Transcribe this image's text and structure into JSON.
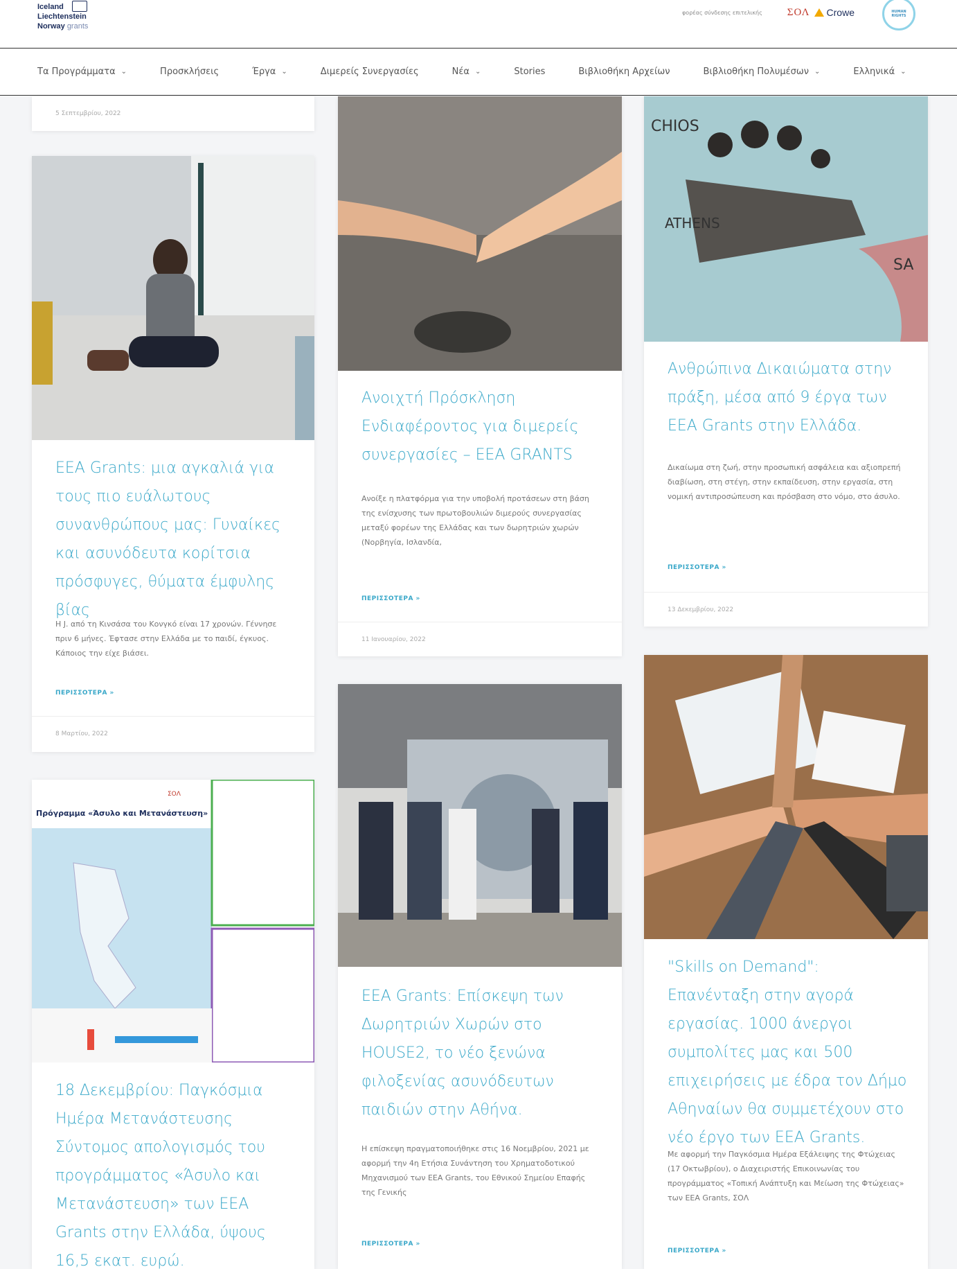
{
  "header": {
    "logo_line1": "Iceland",
    "logo_line2": "Liechtenstein",
    "logo_line3": "Norway",
    "logo_line3_suffix": "grants",
    "tagline": "φορέας σύνδεσης επιτελικής",
    "soa": "ΣΟΛ",
    "crowe": "Crowe",
    "badge": "HUMAN RIGHTS"
  },
  "nav": [
    {
      "label": "Τα Προγράμματα",
      "dropdown": true
    },
    {
      "label": "Προσκλήσεις",
      "dropdown": false
    },
    {
      "label": "Έργα",
      "dropdown": true
    },
    {
      "label": "Διμερείς Συνεργασίες",
      "dropdown": false
    },
    {
      "label": "Νέα",
      "dropdown": true
    },
    {
      "label": "Stories",
      "dropdown": false
    },
    {
      "label": "Βιβλιοθήκη Αρχείων",
      "dropdown": false
    },
    {
      "label": "Βιβλιοθήκη Πολυμέσων",
      "dropdown": true
    },
    {
      "label": "Ελληνικά",
      "dropdown": true
    }
  ],
  "cards": {
    "top_stub": {
      "date": "5 Σεπτεμβρίου, 2022"
    },
    "c1": {
      "title": "EEA Grants: μια αγκαλιά για τους πιο ευάλωτους συνανθρώπους μας: Γυναίκες και ασυνόδευτα κορίτσια πρόσφυγες, θύματα έμφυλης βίας",
      "excerpt": "Η J. από τη Κινσάσα του Κονγκό είναι 17 χρονών. Γέννησε πριν 6 μήνες. Έφτασε στην Ελλάδα με το παιδί, έγκυος. Κάποιος την είχε βιάσει.",
      "more": "ΠΕΡΙΣΣΟΤΕΡΑ »",
      "date": "8 Μαρτίου, 2022"
    },
    "c2": {
      "title": "Ανοιχτή Πρόσκληση Ενδιαφέροντος για διμερείς συνεργασίες – EEA GRANTS",
      "excerpt": "Ανοίξε η πλατφόρμα για την υποβολή προτάσεων στη βάση της ενίσχυσης των πρωτοβουλιών διμερούς συνεργασίας μεταξύ φορέων της Ελλάδας και των δωρητριών χωρών (Νορβηγία, Ισλανδία,",
      "more": "ΠΕΡΙΣΣΟΤΕΡΑ »",
      "date": "11 Ιανουαρίου, 2022"
    },
    "c3": {
      "title": "Ανθρώπινα Δικαιώματα στην πράξη, μέσα από 9 έργα των EEA Grants στην Ελλάδα.",
      "excerpt": "Δικαίωμα στη ζωή, στην προσωπική ασφάλεια και αξιοπρεπή διαβίωση, στη στέγη, στην εκπαίδευση, στην εργασία, στη νομική αντιπροσώπευση και πρόσβαση στο νόμο, στο άσυλο.",
      "more": "ΠΕΡΙΣΣΟΤΕΡΑ »",
      "date": "13 Δεκεμβρίου, 2022"
    },
    "c4": {
      "title": "18 Δεκεμβρίου: Παγκόσμια Ημέρα Μετανάστευσης Σύντομος απολογισμός του προγράμματος «Άσυλο και Μετανάστευση» των EEA Grants στην Ελλάδα, ύψους 16,5 εκατ. ευρώ.",
      "img_heading": "Πρόγραμμα «Άσυλο και Μετανάστευση»",
      "img_soa": "ΣΟΛ"
    },
    "c5": {
      "title": "EEA Grants: Επίσκεψη των Δωρητριών Χωρών στο HOUSE2, το νέο ξενώνα φιλοξενίας ασυνόδευτων παιδιών στην Αθήνα.",
      "excerpt": "Η επίσκεψη πραγματοποιήθηκε στις 16 Νοεμβρίου, 2021 με αφορμή την 4η Ετήσια Συνάντηση του Χρηματοδοτικού Μηχανισμού των EEA Grants, του Εθνικού Σημείου Επαφής της Γενικής",
      "more": "ΠΕΡΙΣΣΟΤΕΡΑ »"
    },
    "c6": {
      "title": "\"Skills on Demand\": Επανένταξη στην αγορά εργασίας. 1000 άνεργοι συμπολίτες μας και 500 επιχειρήσεις με έδρα τον Δήμο Αθηναίων θα συμμετέχουν στο νέο έργο των EEA Grants.",
      "excerpt": "Με αφορμή την Παγκόσμια Ημέρα Εξάλειψης της Φτώχειας (17 Οκτωβρίου), ο Διαχειριστής Επικοινωνίας του προγράμματος «Τοπική Ανάπτυξη και Μείωση της Φτώχειας» των EEA Grants, ΣΟΛ",
      "more": "ΠΕΡΙΣΣΟΤΕΡΑ »"
    }
  }
}
